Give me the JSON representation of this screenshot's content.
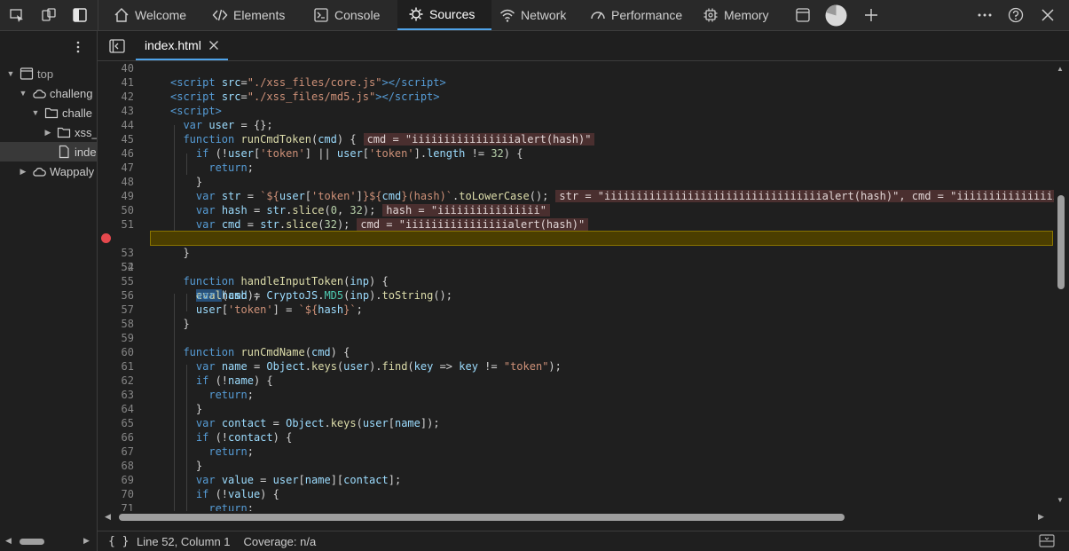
{
  "toolbar": {
    "tabs": [
      {
        "label": "Welcome"
      },
      {
        "label": "Elements"
      },
      {
        "label": "Console"
      },
      {
        "label": "Sources"
      },
      {
        "label": "Network"
      },
      {
        "label": "Performance"
      },
      {
        "label": "Memory"
      }
    ],
    "active_tab": "Sources"
  },
  "navigator": {
    "items": [
      {
        "label": "top"
      },
      {
        "label": "challeng"
      },
      {
        "label": "challe"
      },
      {
        "label": "xss_"
      },
      {
        "label": "inde"
      },
      {
        "label": "Wappaly"
      }
    ]
  },
  "editor": {
    "file_tab": "index.html",
    "paused_line": 52,
    "lines": [
      {
        "n": "40"
      },
      {
        "n": "41"
      },
      {
        "n": "42"
      },
      {
        "n": "43"
      },
      {
        "n": "44"
      },
      {
        "n": "45"
      },
      {
        "n": "46"
      },
      {
        "n": "47"
      },
      {
        "n": "48"
      },
      {
        "n": "49"
      },
      {
        "n": "50"
      },
      {
        "n": "51"
      },
      {
        "n": "52"
      },
      {
        "n": "53"
      },
      {
        "n": "54"
      },
      {
        "n": "55"
      },
      {
        "n": "56"
      },
      {
        "n": "57"
      },
      {
        "n": "58"
      },
      {
        "n": "59"
      },
      {
        "n": "60"
      },
      {
        "n": "61"
      },
      {
        "n": "62"
      },
      {
        "n": "63"
      },
      {
        "n": "64"
      },
      {
        "n": "65"
      },
      {
        "n": "66"
      },
      {
        "n": "67"
      },
      {
        "n": "68"
      },
      {
        "n": "69"
      },
      {
        "n": "70"
      },
      {
        "n": "71"
      }
    ],
    "code": {
      "l41_src": "./xss_files/core.js",
      "l42_src": "./xss_files/md5.js",
      "l45_hint": "cmd = \"iiiiiiiiiiiiiiiialert(hash)\"",
      "l49_hint": "str = \"iiiiiiiiiiiiiiiiiiiiiiiiiiiiiiiiiialert(hash)\", cmd = \"iiiiiiiiiiiiiiiiiiiialert(hash)\"",
      "l50_hint": "hash = \"iiiiiiiiiiiiiiii\"",
      "l51_hint": "cmd = \"iiiiiiiiiiiiiiiialert(hash)\""
    }
  },
  "status": {
    "braces": "{ }",
    "position": "Line 52, Column 1",
    "coverage": "Coverage: n/a"
  },
  "colors": {
    "accent": "#4fa3e9",
    "breakpoint": "#e5484d",
    "paused_line_bg": "#4b3e00"
  }
}
